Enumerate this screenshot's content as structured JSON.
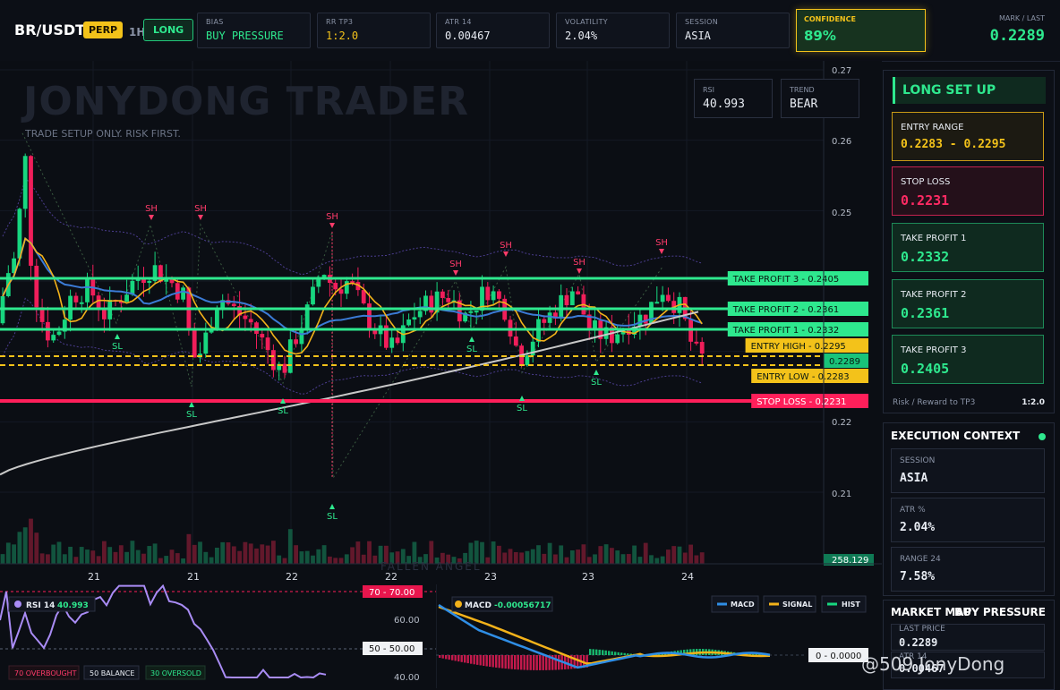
{
  "header": {
    "symbol": "BR/USDT",
    "market_type": "PERP",
    "timeframe": "1H",
    "direction": "LONG",
    "cards": [
      {
        "label": "BIAS",
        "value": "BUY PRESSURE",
        "color": "#2ee88e"
      },
      {
        "label": "RR TP3",
        "value": "1:2.0",
        "color": "#f3c21a"
      },
      {
        "label": "ATR 14",
        "value": "0.00467",
        "color": "#e8ecf3"
      },
      {
        "label": "VOLATILITY",
        "value": "2.04%",
        "color": "#e8ecf3"
      },
      {
        "label": "SESSION",
        "value": "ASIA",
        "color": "#e8ecf3"
      }
    ],
    "confidence": {
      "label": "CONFIDENCE",
      "value": "89%"
    },
    "mark": {
      "label": "MARK / LAST",
      "value": "0.2289"
    }
  },
  "chart": {
    "watermark": "JONYDONG TRADER",
    "subtitle": "TRADE SETUP ONLY. RISK FIRST.",
    "rsi_box": {
      "label": "RSI",
      "value": "40.993"
    },
    "trend_box": {
      "label": "TREND",
      "value": "BEAR"
    },
    "y_ticks": [
      "0.27",
      "0.26",
      "0.25",
      "0.22",
      "0.21"
    ],
    "x_ticks": [
      "21",
      "21",
      "22",
      "22",
      "23",
      "23",
      "24"
    ],
    "volume_label": "258.129",
    "bottom_watermark": "FALLEN ANGEL",
    "swing_high_label": "SH",
    "swing_low_label": "SL",
    "levels": [
      {
        "name": "TAKE PROFIT 3",
        "price": "0.2405",
        "kind": "tp"
      },
      {
        "name": "TAKE PROFIT 2",
        "price": "0.2361",
        "kind": "tp"
      },
      {
        "name": "TAKE PROFIT 1",
        "price": "0.2332",
        "kind": "tp"
      },
      {
        "name": "ENTRY HIGH",
        "price": "0.2295",
        "kind": "entry"
      },
      {
        "name": "",
        "price": "0.2289",
        "kind": "last"
      },
      {
        "name": "ENTRY LOW",
        "price": "0.2283",
        "kind": "entry"
      },
      {
        "name": "STOP LOSS",
        "price": "0.2231",
        "kind": "sl"
      }
    ],
    "colors": {
      "up": "#17d67f",
      "down": "#f01e5a",
      "ema_fast": "#f3b21a",
      "ema_slow": "#3b7bd6",
      "sma": "#c8c8c8",
      "tp": "#2ee88e",
      "entry": "#f3c21a",
      "sl": "#ff1f5a"
    }
  },
  "rsi_panel": {
    "title": "RSI 14",
    "value": "40.993",
    "legend": [
      "70 OVERBOUGHT",
      "50 BALANCE",
      "30 OVERSOLD"
    ],
    "tag70": "70 - 70.00",
    "tag50": "50 - 50.00",
    "ticks": [
      "60.00",
      "40.00"
    ]
  },
  "macd_panel": {
    "title": "MACD",
    "value": "-0.00056717",
    "legend": [
      "MACD",
      "SIGNAL",
      "HIST"
    ],
    "zero_tag": "0 - 0.0000"
  },
  "setup": {
    "title": "LONG SET UP",
    "items": [
      {
        "label": "ENTRY RANGE",
        "value": "0.2283 - 0.2295",
        "color": "#f3c21a"
      },
      {
        "label": "STOP LOSS",
        "value": "0.2231",
        "color": "#ff2a63"
      },
      {
        "label": "TAKE PROFIT 1",
        "value": "0.2332",
        "color": "#2ee88e"
      },
      {
        "label": "TAKE PROFIT 2",
        "value": "0.2361",
        "color": "#2ee88e"
      },
      {
        "label": "TAKE PROFIT 3",
        "value": "0.2405",
        "color": "#2ee88e"
      }
    ],
    "rr_label": "Risk / Reward to TP3",
    "rr_value": "1:2.0"
  },
  "execution": {
    "title": "EXECUTION CONTEXT",
    "items": [
      {
        "label": "SESSION",
        "value": "ASIA"
      },
      {
        "label": "ATR %",
        "value": "2.04%"
      },
      {
        "label": "RANGE 24",
        "value": "7.58%"
      }
    ]
  },
  "market_map": {
    "title": "MARKET MAP",
    "bias": "BUY PRESSURE",
    "items": [
      {
        "label": "LAST PRICE",
        "value": "0.2289"
      },
      {
        "label": "ATR 14",
        "value": "0.00467"
      }
    ]
  },
  "credit": "@509 JonyDong"
}
